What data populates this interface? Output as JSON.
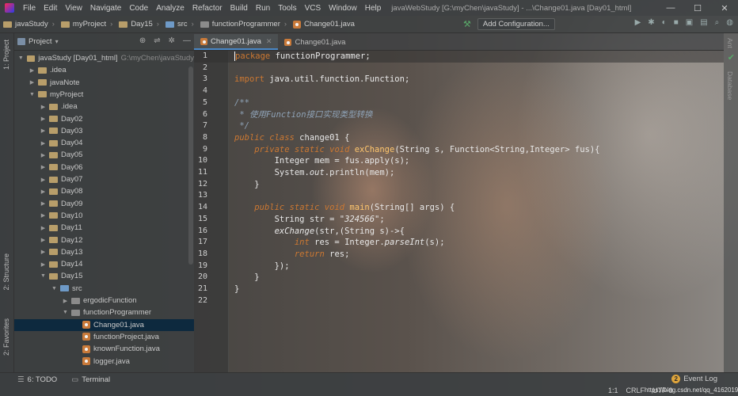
{
  "window": {
    "menu": [
      "File",
      "Edit",
      "View",
      "Navigate",
      "Code",
      "Analyze",
      "Refactor",
      "Build",
      "Run",
      "Tools",
      "VCS",
      "Window",
      "Help"
    ],
    "title": "javaWebStudy [G:\\myChen\\javaStudy] - ...\\Change01.java [Day01_html]",
    "controls": {
      "minimize": "—",
      "maximize": "☐",
      "close": "✕"
    }
  },
  "breadcrumbs": [
    "javaStudy",
    "myProject",
    "Day15",
    "src",
    "functionProgrammer",
    "Change01.java"
  ],
  "toolbar": {
    "add_config": "Add Configuration..."
  },
  "side_tabs": {
    "project": "1: Project",
    "structure": "2: Structure",
    "favorites": "2: Favorites",
    "ant": "Ant",
    "database": "Database"
  },
  "project_panel": {
    "title": "Project",
    "tree": [
      {
        "label": "javaStudy [Day01_html]",
        "extra": "G:\\myChen\\javaStudy",
        "depth": 0,
        "expanded": true,
        "kind": "module"
      },
      {
        "label": ".idea",
        "depth": 1,
        "expanded": false,
        "kind": "folder"
      },
      {
        "label": "javaNote",
        "depth": 1,
        "expanded": false,
        "kind": "folder"
      },
      {
        "label": "myProject",
        "depth": 1,
        "expanded": true,
        "kind": "folder"
      },
      {
        "label": ".idea",
        "depth": 2,
        "expanded": false,
        "kind": "folder"
      },
      {
        "label": "Day02",
        "depth": 2,
        "expanded": false,
        "kind": "folder"
      },
      {
        "label": "Day03",
        "depth": 2,
        "expanded": false,
        "kind": "folder"
      },
      {
        "label": "Day04",
        "depth": 2,
        "expanded": false,
        "kind": "folder"
      },
      {
        "label": "Day05",
        "depth": 2,
        "expanded": false,
        "kind": "folder"
      },
      {
        "label": "Day06",
        "depth": 2,
        "expanded": false,
        "kind": "folder"
      },
      {
        "label": "Day07",
        "depth": 2,
        "expanded": false,
        "kind": "folder"
      },
      {
        "label": "Day08",
        "depth": 2,
        "expanded": false,
        "kind": "folder"
      },
      {
        "label": "Day09",
        "depth": 2,
        "expanded": false,
        "kind": "folder"
      },
      {
        "label": "Day10",
        "depth": 2,
        "expanded": false,
        "kind": "folder"
      },
      {
        "label": "Day11",
        "depth": 2,
        "expanded": false,
        "kind": "folder"
      },
      {
        "label": "Day12",
        "depth": 2,
        "expanded": false,
        "kind": "folder"
      },
      {
        "label": "Day13",
        "depth": 2,
        "expanded": false,
        "kind": "folder"
      },
      {
        "label": "Day14",
        "depth": 2,
        "expanded": false,
        "kind": "folder"
      },
      {
        "label": "Day15",
        "depth": 2,
        "expanded": true,
        "kind": "folder"
      },
      {
        "label": "src",
        "depth": 3,
        "expanded": true,
        "kind": "src"
      },
      {
        "label": "ergodicFunction",
        "depth": 4,
        "expanded": false,
        "kind": "pkg"
      },
      {
        "label": "functionProgrammer",
        "depth": 4,
        "expanded": true,
        "kind": "pkg"
      },
      {
        "label": "Change01.java",
        "depth": 5,
        "kind": "java",
        "selected": true
      },
      {
        "label": "functionProject.java",
        "depth": 5,
        "kind": "java"
      },
      {
        "label": "knownFunction.java",
        "depth": 5,
        "kind": "java"
      },
      {
        "label": "logger.java",
        "depth": 5,
        "kind": "java"
      }
    ]
  },
  "editor": {
    "tabs": [
      {
        "label": "Change01.java",
        "active": true
      },
      {
        "label": "Change01.java",
        "active": false
      }
    ],
    "lines": [
      "1",
      "2",
      "3",
      "4",
      "5",
      "6",
      "7",
      "8",
      "9",
      "10",
      "11",
      "12",
      "13",
      "14",
      "15",
      "16",
      "17",
      "18",
      "19",
      "20",
      "21",
      "22"
    ]
  },
  "statusbar": {
    "todo": "6: TODO",
    "terminal": "Terminal",
    "event_count": "2",
    "event_log": "Event Log",
    "position": "1:1",
    "line_sep": "CRLF",
    "encoding": "UTF-8",
    "watermark": "https://blog.csdn.net/qq_41620193"
  },
  "colors": {
    "keyword": "#cc7832",
    "comment": "#8fa3b7",
    "method": "#ffc66d",
    "selection": "#0d293e",
    "accent": "#4a88c7"
  }
}
